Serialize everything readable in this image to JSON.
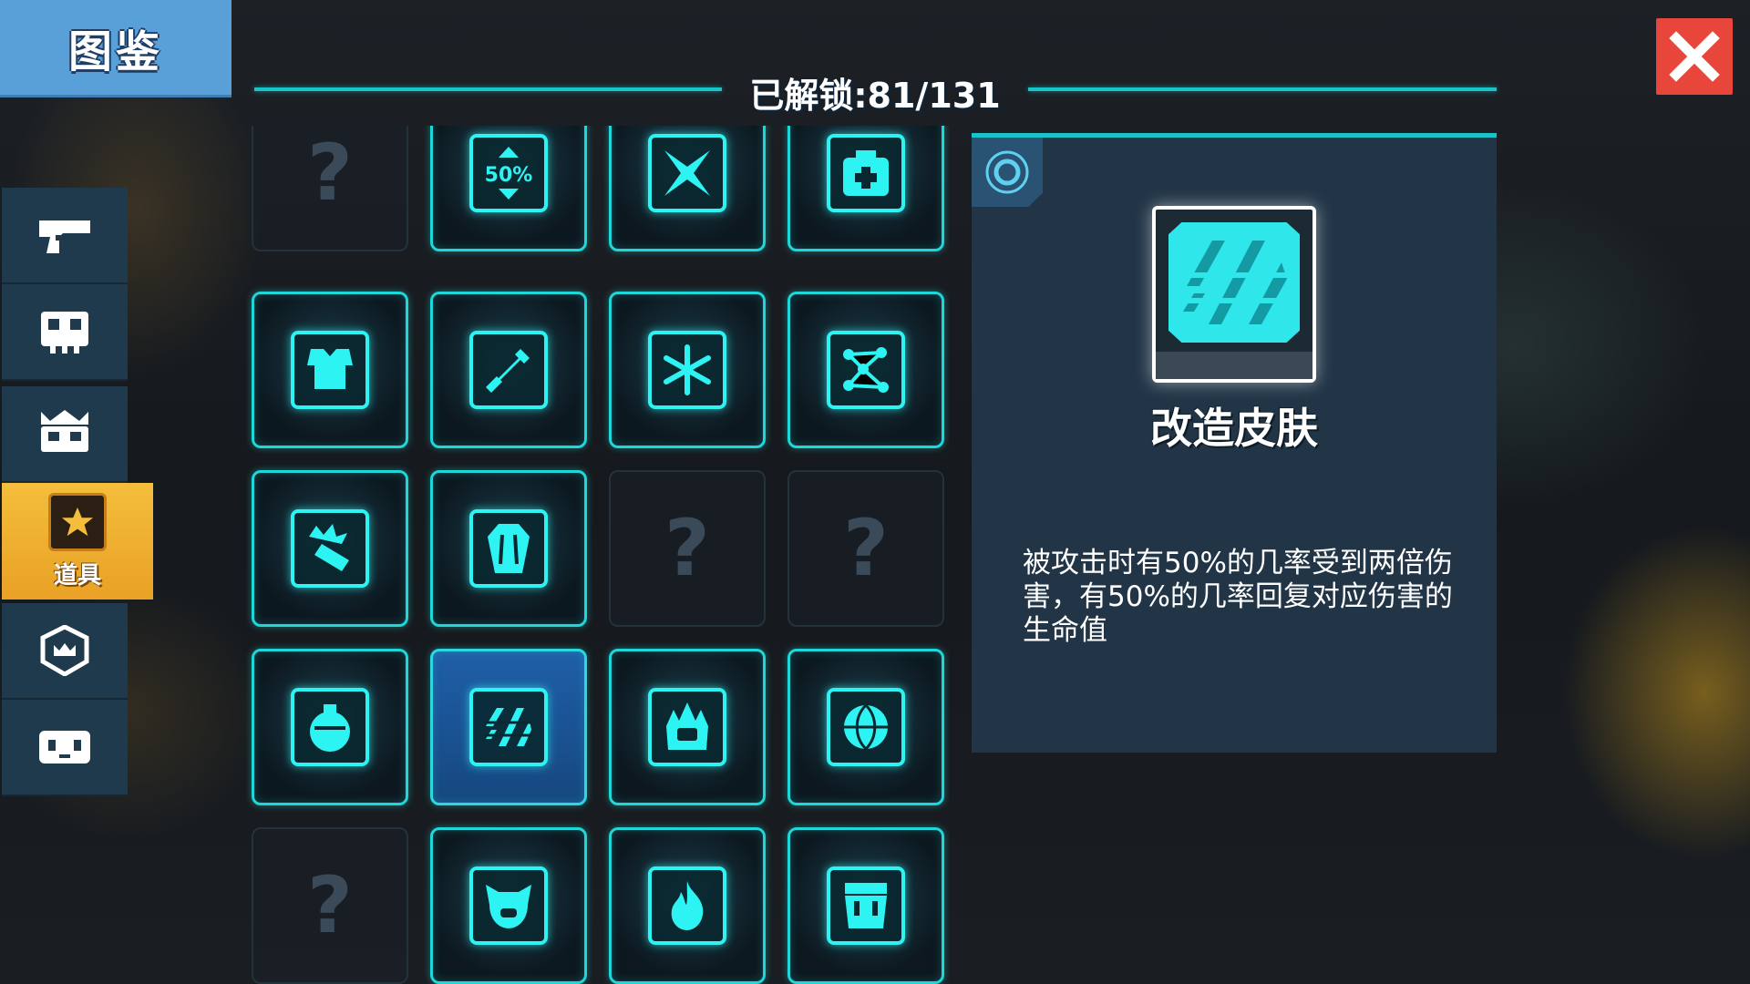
{
  "header": {
    "title": "图鉴",
    "unlock_text": "已解锁:81/131"
  },
  "sidebar": {
    "items": [
      {
        "icon": "pistol-icon",
        "label": ""
      },
      {
        "icon": "skull-mask-icon",
        "label": ""
      },
      {
        "icon": "crowned-skull-icon",
        "label": ""
      },
      {
        "icon": "star-icon",
        "label": "道具",
        "active": true
      },
      {
        "icon": "shield-crown-icon",
        "label": ""
      },
      {
        "icon": "helmet-icon",
        "label": ""
      }
    ]
  },
  "grid": {
    "items": [
      {
        "icon": "unknown",
        "locked": true
      },
      {
        "icon": "half-percent-icon",
        "text": "50%"
      },
      {
        "icon": "shuriken-icon"
      },
      {
        "icon": "medkit-icon"
      },
      {
        "icon": "armor-vest-icon"
      },
      {
        "icon": "syringe-icon"
      },
      {
        "icon": "snowflake-icon"
      },
      {
        "icon": "network-nodes-icon"
      },
      {
        "icon": "explosive-shell-icon"
      },
      {
        "icon": "coffin-icon"
      },
      {
        "icon": "unknown",
        "locked": true
      },
      {
        "icon": "unknown",
        "locked": true
      },
      {
        "icon": "potion-flask-icon"
      },
      {
        "icon": "striped-skin-icon",
        "selected": true
      },
      {
        "icon": "flame-helmet-icon"
      },
      {
        "icon": "basketball-icon"
      },
      {
        "icon": "unknown",
        "locked": true
      },
      {
        "icon": "pig-face-icon"
      },
      {
        "icon": "fire-icon"
      },
      {
        "icon": "backpack-icon"
      }
    ],
    "locked_glyph": "?"
  },
  "detail": {
    "name": "改造皮肤",
    "description": "被攻击时有50%的几率受到两倍伤害，有50%的几率回复对应伤害的生命值",
    "icon": "striped-skin-icon"
  },
  "colors": {
    "accent_cyan": "#1fd6d8",
    "close_red": "#e9463b",
    "active_tab_gold": "#f4be3c",
    "title_blue": "#5aa0d8"
  }
}
